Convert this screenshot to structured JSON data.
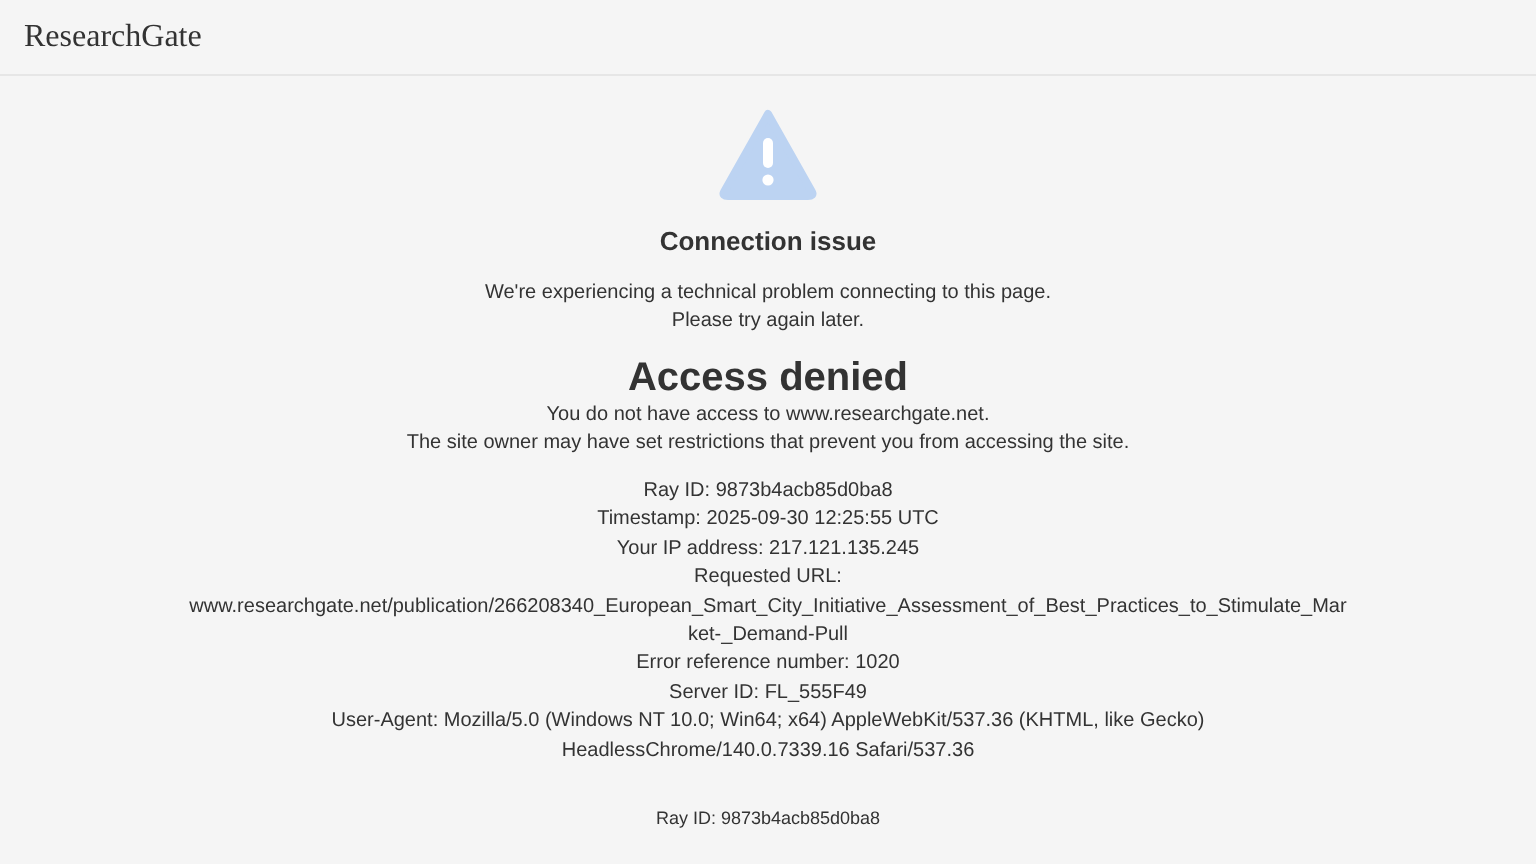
{
  "header": {
    "logo": "ResearchGate"
  },
  "notice": {
    "title": "Connection issue",
    "message_lines": [
      "We're experiencing a technical problem connecting to this page.",
      "Please try again later."
    ]
  },
  "error": {
    "title": "Access denied",
    "message_lines": [
      "You do not have access to www.researchgate.net.",
      "The site owner may have set restrictions that prevent you from accessing the site."
    ],
    "details": [
      "Ray ID: 9873b4acb85d0ba8",
      "Timestamp: 2025-09-30 12:25:55 UTC",
      "Your IP address: 217.121.135.245",
      "Requested URL:",
      "www.researchgate.net/publication/266208340_European_Smart_City_Initiative_Assessment_of_Best_Practices_to_Stimulate_Market-_Demand-Pull",
      "Error reference number: 1020",
      "Server ID: FL_555F49",
      "User-Agent: Mozilla/5.0 (Windows NT 10.0; Win64; x64) AppleWebKit/537.36 (KHTML, like Gecko) HeadlessChrome/140.0.7339.16 Safari/537.36"
    ]
  },
  "footer": {
    "ray_id": "Ray ID: 9873b4acb85d0ba8"
  }
}
